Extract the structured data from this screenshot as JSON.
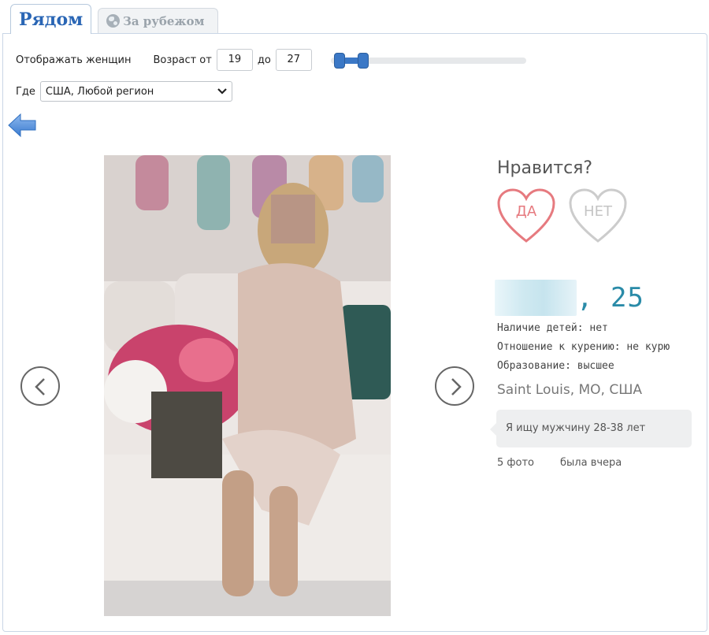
{
  "tabs": {
    "active_label": "Рядом",
    "inactive_label": "За рубежом"
  },
  "filters": {
    "show_label": "Отображать женщин",
    "age_label": "Возраст от",
    "age_from": "19",
    "age_to_label": "до",
    "age_to": "27",
    "where_label": "Где",
    "where_value": "США, Любой регион"
  },
  "age_slider": {
    "min": 18,
    "max": 80,
    "from": 19,
    "to": 27
  },
  "profile": {
    "like_title": "Нравится?",
    "yes_label": "ДА",
    "no_label": "НЕТ",
    "age_text": ", 25",
    "children": "Наличие детей: нет",
    "smoking": "Отношение к курению: не курю",
    "education": "Образование: высшее",
    "city": "Saint Louis, MO, США",
    "seeking": "Я ищу мужчину 28-38 лет",
    "photos_count": "5 фото",
    "last_seen": "была вчера"
  },
  "colors": {
    "accent_blue": "#2a66b5",
    "age_color": "#2a8ba8",
    "heart_yes": "#e67a7f",
    "heart_no": "#c4c4c4"
  },
  "icons": {
    "back": "back-arrow-icon",
    "prev": "chevron-left-icon",
    "next": "chevron-right-icon",
    "globe": "globe-icon"
  }
}
